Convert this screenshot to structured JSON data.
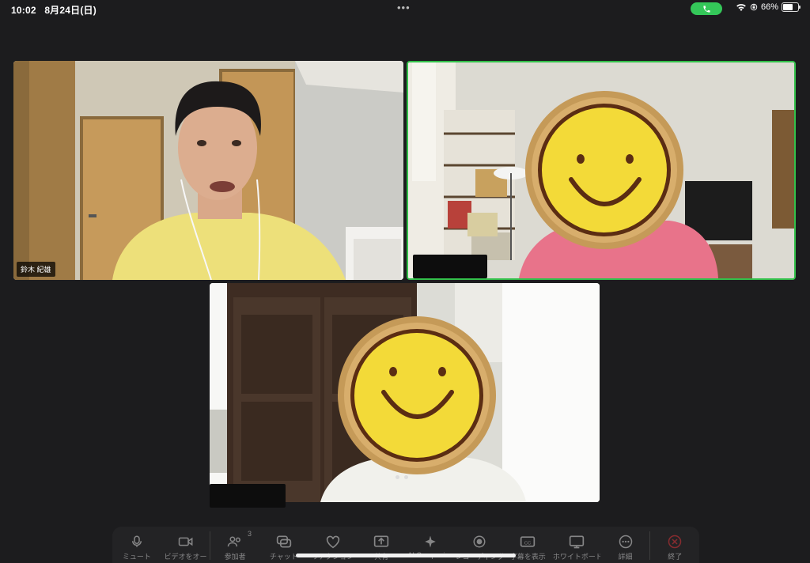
{
  "status_bar": {
    "time": "10:02",
    "date": "8月24日(日)",
    "more_dots": "•••",
    "battery_percent_label": "66%",
    "battery_level": 0.66
  },
  "participants": [
    {
      "name": "鈴木 紀雄",
      "active_speaker": false
    },
    {
      "name": "",
      "active_speaker": true
    },
    {
      "name": "",
      "active_speaker": false
    }
  ],
  "toolbar": {
    "items": [
      {
        "label": "ミュート",
        "icon": "mic-icon"
      },
      {
        "label": "ビデオをオー",
        "icon": "video-camera-icon"
      },
      {
        "label": "参加者",
        "icon": "participants-icon",
        "badge": "3"
      },
      {
        "label": "チャット",
        "icon": "chat-icon"
      },
      {
        "label": "リアクション",
        "icon": "heart-icon"
      },
      {
        "label": "共有",
        "icon": "share-screen-icon"
      },
      {
        "label": "AI Companion",
        "icon": "ai-sparkle-icon"
      },
      {
        "label": "レコーディング",
        "icon": "record-icon"
      },
      {
        "label": "字幕を表示",
        "icon": "captions-icon"
      },
      {
        "label": "ホワイトボード",
        "icon": "whiteboard-icon"
      },
      {
        "label": "詳細",
        "icon": "more-icon"
      },
      {
        "label": "終了",
        "icon": "end-icon"
      }
    ]
  },
  "colors": {
    "background": "#1c1c1e",
    "active_speaker_border": "#33c04a",
    "call_pill": "#34c759",
    "end_red": "#e0383e"
  }
}
